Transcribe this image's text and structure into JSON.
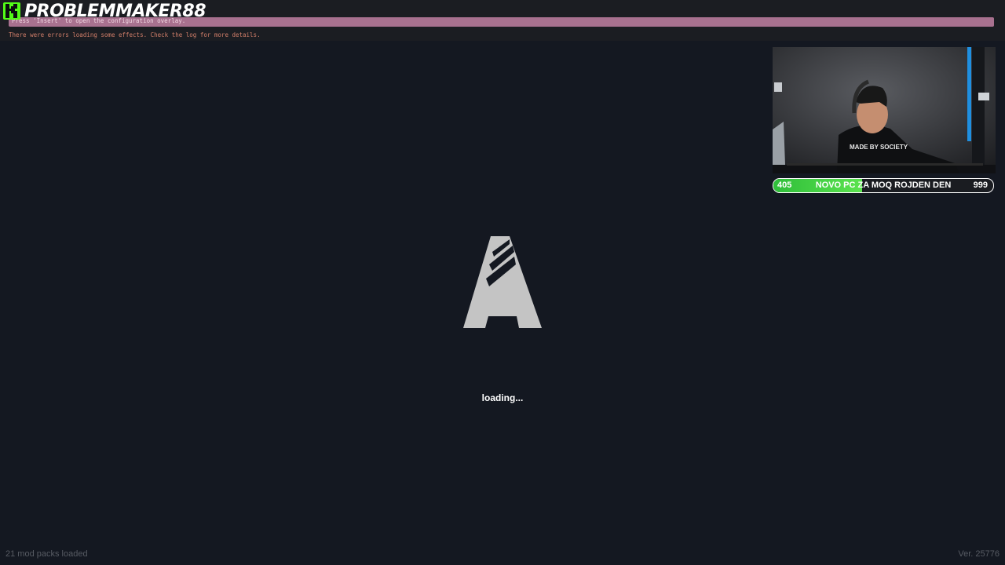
{
  "overlay": {
    "hint": "Press 'Insert' to open the configuration overlay.",
    "error": "There were errors loading some effects. Check the log for more details."
  },
  "stream": {
    "platform_icon": "kick-logo-icon",
    "channel": "PROBLEMMAKER88",
    "webcam_shirt_text": "MADE BY SOCIETY",
    "goal": {
      "current": "405",
      "title": "NOVO PC ZA MOQ ROJDEN DEN",
      "target": "999",
      "progress_fraction": 0.405
    }
  },
  "game": {
    "logo_icon": "fivem-logo-icon",
    "loading_text": "loading...",
    "mod_packs": "21 mod packs loaded",
    "version": "Ver. 25776"
  },
  "colors": {
    "background": "#141821",
    "kick_green": "#53fc18",
    "banner_pink": "#a8718f",
    "error_text": "#d27f6a",
    "goal_green": "#3ccf45"
  }
}
